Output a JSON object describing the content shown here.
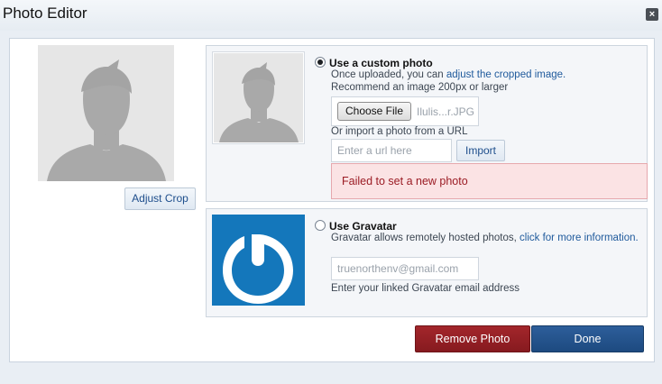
{
  "dialog": {
    "title": "Photo Editor",
    "close_label": "×"
  },
  "left": {
    "adjust_crop_label": "Adjust Crop"
  },
  "custom_photo": {
    "selected": true,
    "title": "Use a custom photo",
    "desc_prefix": "Once uploaded, you can ",
    "desc_link": "adjust the cropped image.",
    "recommend": "Recommend an image 200px or larger",
    "choose_file_label": "Choose File",
    "file_name": "Ilulis...r.JPG",
    "import_hint": "Or import a photo from a URL",
    "url_placeholder": "Enter a url here",
    "import_label": "Import",
    "error_message": "Failed to set a new photo"
  },
  "gravatar": {
    "selected": false,
    "title": "Use Gravatar",
    "desc": "Gravatar allows remotely hosted photos, ",
    "desc_link": "click for more information.",
    "email_value": "truenorthenv@gmail.com",
    "email_hint": "Enter your linked Gravatar email address"
  },
  "actions": {
    "remove_label": "Remove Photo",
    "done_label": "Done"
  },
  "colors": {
    "remove_button": "#96202a",
    "done_button": "#23518b",
    "gravatar_bg": "#1477bb",
    "error_bg": "#fbe3e4"
  }
}
